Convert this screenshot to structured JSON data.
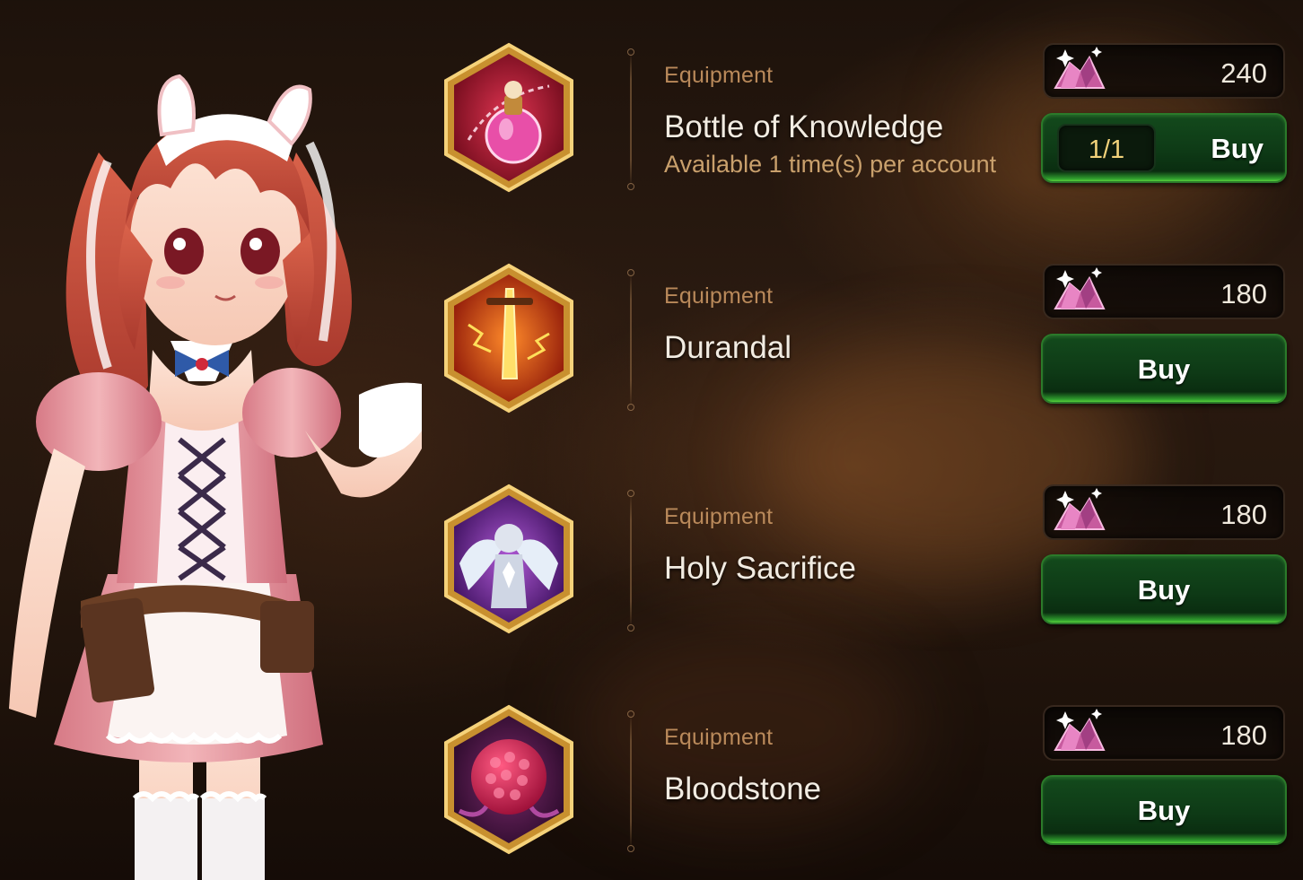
{
  "shop": {
    "items": [
      {
        "category": "Equipment",
        "name": "Bottle of Knowledge",
        "limit": "Available 1 time(s) per account",
        "price": "240",
        "stock": "1/1",
        "buy_label": "Buy",
        "icon": "bottle-of-knowledge-icon"
      },
      {
        "category": "Equipment",
        "name": "Durandal",
        "price": "180",
        "buy_label": "Buy",
        "icon": "durandal-icon"
      },
      {
        "category": "Equipment",
        "name": "Holy Sacrifice",
        "price": "180",
        "buy_label": "Buy",
        "icon": "holy-sacrifice-icon"
      },
      {
        "category": "Equipment",
        "name": "Bloodstone",
        "price": "180",
        "buy_label": "Buy",
        "icon": "bloodstone-icon"
      }
    ],
    "currency_icon": "skystone-gem-icon"
  },
  "colors": {
    "accent_gold": "#d7a23a",
    "buy_green": "#2e9a2d",
    "category_text": "#b9895a",
    "limit_text": "#c9a06c"
  }
}
